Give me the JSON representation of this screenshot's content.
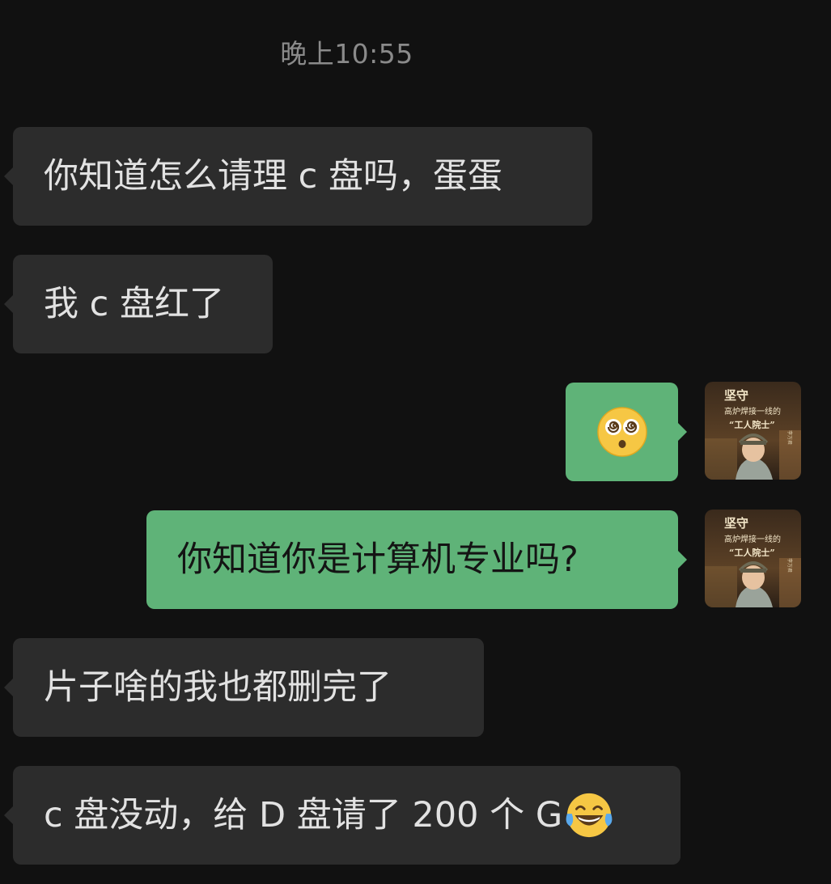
{
  "timestamp": "晚上10:55",
  "messages": [
    {
      "side": "in",
      "text": "你知道怎么请理 c 盘吗，蛋蛋"
    },
    {
      "side": "in",
      "text": "我 c 盘红了"
    },
    {
      "side": "out",
      "emoji": "dizzy-face-emoji"
    },
    {
      "side": "out",
      "text": "你知道你是计算机专业吗?"
    },
    {
      "side": "in",
      "text": "片子啥的我也都删完了"
    },
    {
      "side": "in",
      "text": "c 盘没动，给 D 盘请了 200 个 G",
      "trailing_emoji": "laughing-tears-emoji"
    }
  ],
  "avatar": {
    "title_line1": "坚守",
    "title_line2": "高炉焊接一线的",
    "title_line3": "“工人院士”",
    "signature": "李万君"
  }
}
